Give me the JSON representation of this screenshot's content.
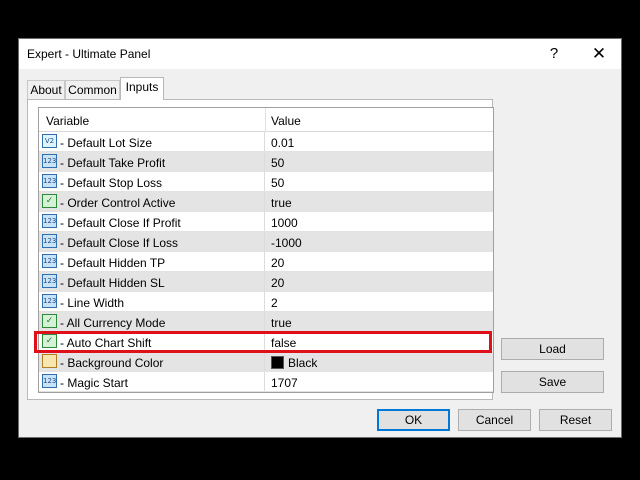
{
  "window": {
    "title": "Expert - Ultimate Panel",
    "help_label": "?",
    "close_label": "✕"
  },
  "tabs": [
    {
      "label": "About"
    },
    {
      "label": "Common"
    },
    {
      "label": "Inputs",
      "active": true
    }
  ],
  "grid": {
    "headers": {
      "variable": "Variable",
      "value": "Value"
    },
    "rows": [
      {
        "icon": "double-icon",
        "glyph": "V2",
        "name": "- Default Lot Size",
        "value": "0.01"
      },
      {
        "icon": "integer-icon",
        "glyph": "123",
        "name": "- Default Take Profit",
        "value": "50"
      },
      {
        "icon": "integer-icon",
        "glyph": "123",
        "name": "- Default Stop Loss",
        "value": "50"
      },
      {
        "icon": "boolean-icon",
        "glyph": "✓",
        "name": "- Order Control Active",
        "value": "true"
      },
      {
        "icon": "integer-icon",
        "glyph": "123",
        "name": "- Default Close If Profit",
        "value": "1000"
      },
      {
        "icon": "integer-icon",
        "glyph": "123",
        "name": "- Default Close If Loss",
        "value": "-1000"
      },
      {
        "icon": "integer-icon",
        "glyph": "123",
        "name": "- Default Hidden TP",
        "value": "20"
      },
      {
        "icon": "integer-icon",
        "glyph": "123",
        "name": "- Default Hidden SL",
        "value": "20"
      },
      {
        "icon": "integer-icon",
        "glyph": "123",
        "name": "- Line Width",
        "value": "2"
      },
      {
        "icon": "boolean-icon",
        "glyph": "✓",
        "name": "- All Currency Mode",
        "value": "true"
      },
      {
        "icon": "boolean-icon",
        "glyph": "✓",
        "name": "- Auto Chart Shift",
        "value": "false"
      },
      {
        "icon": "color-icon",
        "glyph": "",
        "name": "- Background Color",
        "value": "Black",
        "swatch": "#000000"
      },
      {
        "icon": "integer-icon",
        "glyph": "123",
        "name": "- Magic Start",
        "value": "1707"
      }
    ]
  },
  "side_buttons": {
    "load": "Load",
    "save": "Save"
  },
  "footer_buttons": {
    "ok": "OK",
    "cancel": "Cancel",
    "reset": "Reset"
  },
  "colors": {
    "highlight": "#e0101a",
    "default_button_border": "#0078d7"
  }
}
